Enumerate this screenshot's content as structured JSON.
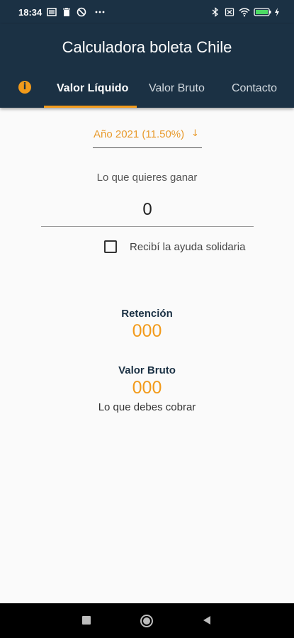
{
  "status_bar": {
    "time": "18:34",
    "icons": [
      "gallery-icon",
      "trash-icon",
      "blocked-icon",
      "more-dots-icon",
      "bluetooth-icon",
      "sim-icon",
      "wifi-icon",
      "battery-icon"
    ]
  },
  "app": {
    "title": "Calculadora boleta Chile"
  },
  "tabs": [
    {
      "label": "Valor Líquido",
      "active": true
    },
    {
      "label": "Valor Bruto",
      "active": false
    },
    {
      "label": "Contacto",
      "active": false
    }
  ],
  "form": {
    "year_option": "Año 2021 (11.50%)",
    "amount_label": "Lo que quieres ganar",
    "amount_value": "0",
    "checkbox_label": "Recibí la ayuda solidaria",
    "checkbox_checked": false
  },
  "results": {
    "retention_title": "Retención",
    "retention_value": "000",
    "gross_title": "Valor Bruto",
    "gross_value": "000",
    "gross_caption": "Lo que debes cobrar"
  },
  "colors": {
    "primary": "#1b3144",
    "accent": "#f29a1a",
    "background": "#fafafa"
  },
  "nav_bar": {
    "buttons": [
      "recents-button",
      "home-button",
      "back-button"
    ]
  }
}
